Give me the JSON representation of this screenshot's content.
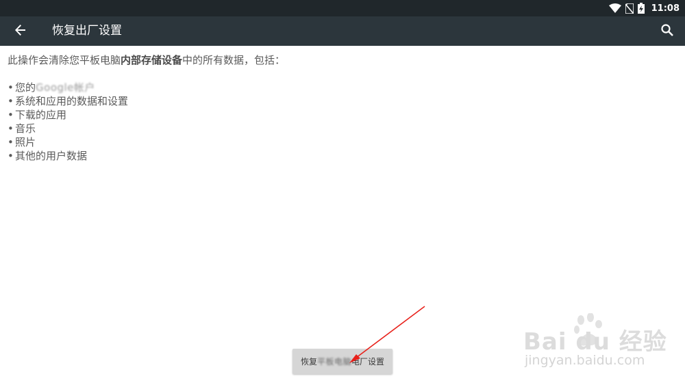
{
  "status_bar": {
    "time": "11:08",
    "icons": [
      "wifi-icon",
      "no-sim-icon",
      "battery-charging-icon"
    ]
  },
  "toolbar": {
    "back_icon": "arrow-back-icon",
    "title": "恢复出厂设置",
    "search_icon": "search-icon"
  },
  "content": {
    "intro_before": "此操作会清除您平板电脑",
    "intro_bold": "内部存储设备",
    "intro_after": "中的所有数据，包括：",
    "items": [
      {
        "bullet": "•",
        "label": "您的",
        "blurred": "Google帐户"
      },
      {
        "bullet": "•",
        "label": "系统和应用的数据和设置"
      },
      {
        "bullet": "•",
        "label": "下载的应用"
      },
      {
        "bullet": "•",
        "label": "音乐"
      },
      {
        "bullet": "•",
        "label": "照片"
      },
      {
        "bullet": "•",
        "label": "其他的用户数据"
      }
    ]
  },
  "reset_button": {
    "label_start": "恢复",
    "label_blurred": "平板电脑",
    "label_end": "电厂设置"
  },
  "watermark": {
    "brand": "Bai du 经验",
    "url": "jingyan.baidu.com"
  },
  "colors": {
    "status_bar": "#20272b",
    "toolbar": "#2c363c",
    "annotation_arrow": "#e8201a"
  }
}
